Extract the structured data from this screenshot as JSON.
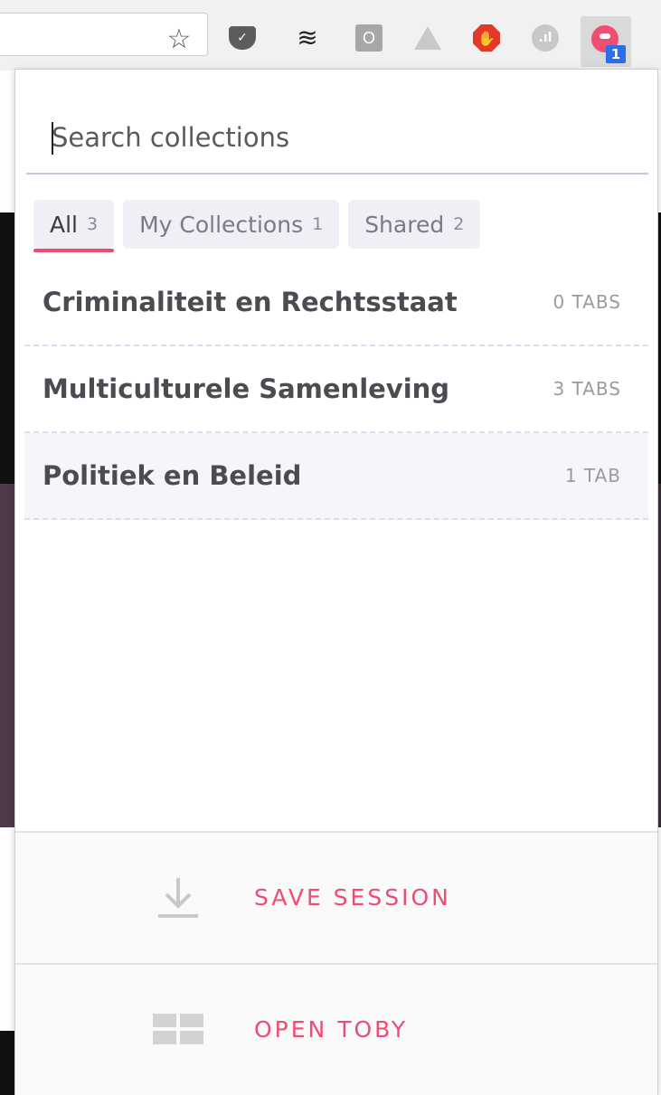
{
  "browser": {
    "star_glyph": "☆",
    "extensions": [
      "pocket-icon",
      "buffer-icon",
      "outline-icon",
      "drive-icon",
      "adblock-icon",
      "analytics-icon",
      "toby-icon"
    ],
    "toby_badge": "1"
  },
  "search": {
    "placeholder": "Search collections",
    "value": ""
  },
  "tabs": [
    {
      "label": "All",
      "count": "3"
    },
    {
      "label": "My Collections",
      "count": "1"
    },
    {
      "label": "Shared",
      "count": "2"
    }
  ],
  "collections": [
    {
      "name": "Criminaliteit en Rechtsstaat",
      "tabs": "0 TABS"
    },
    {
      "name": "Multiculturele Samenleving",
      "tabs": "3 TABS"
    },
    {
      "name": "Politiek en Beleid",
      "tabs": "1 TAB"
    }
  ],
  "footer": {
    "save_label": "SAVE SESSION",
    "open_label": "OPEN TOBY"
  },
  "colors": {
    "accent": "#ee4c72",
    "tab_bg": "#f0eff5",
    "divider": "#dcdcee"
  }
}
